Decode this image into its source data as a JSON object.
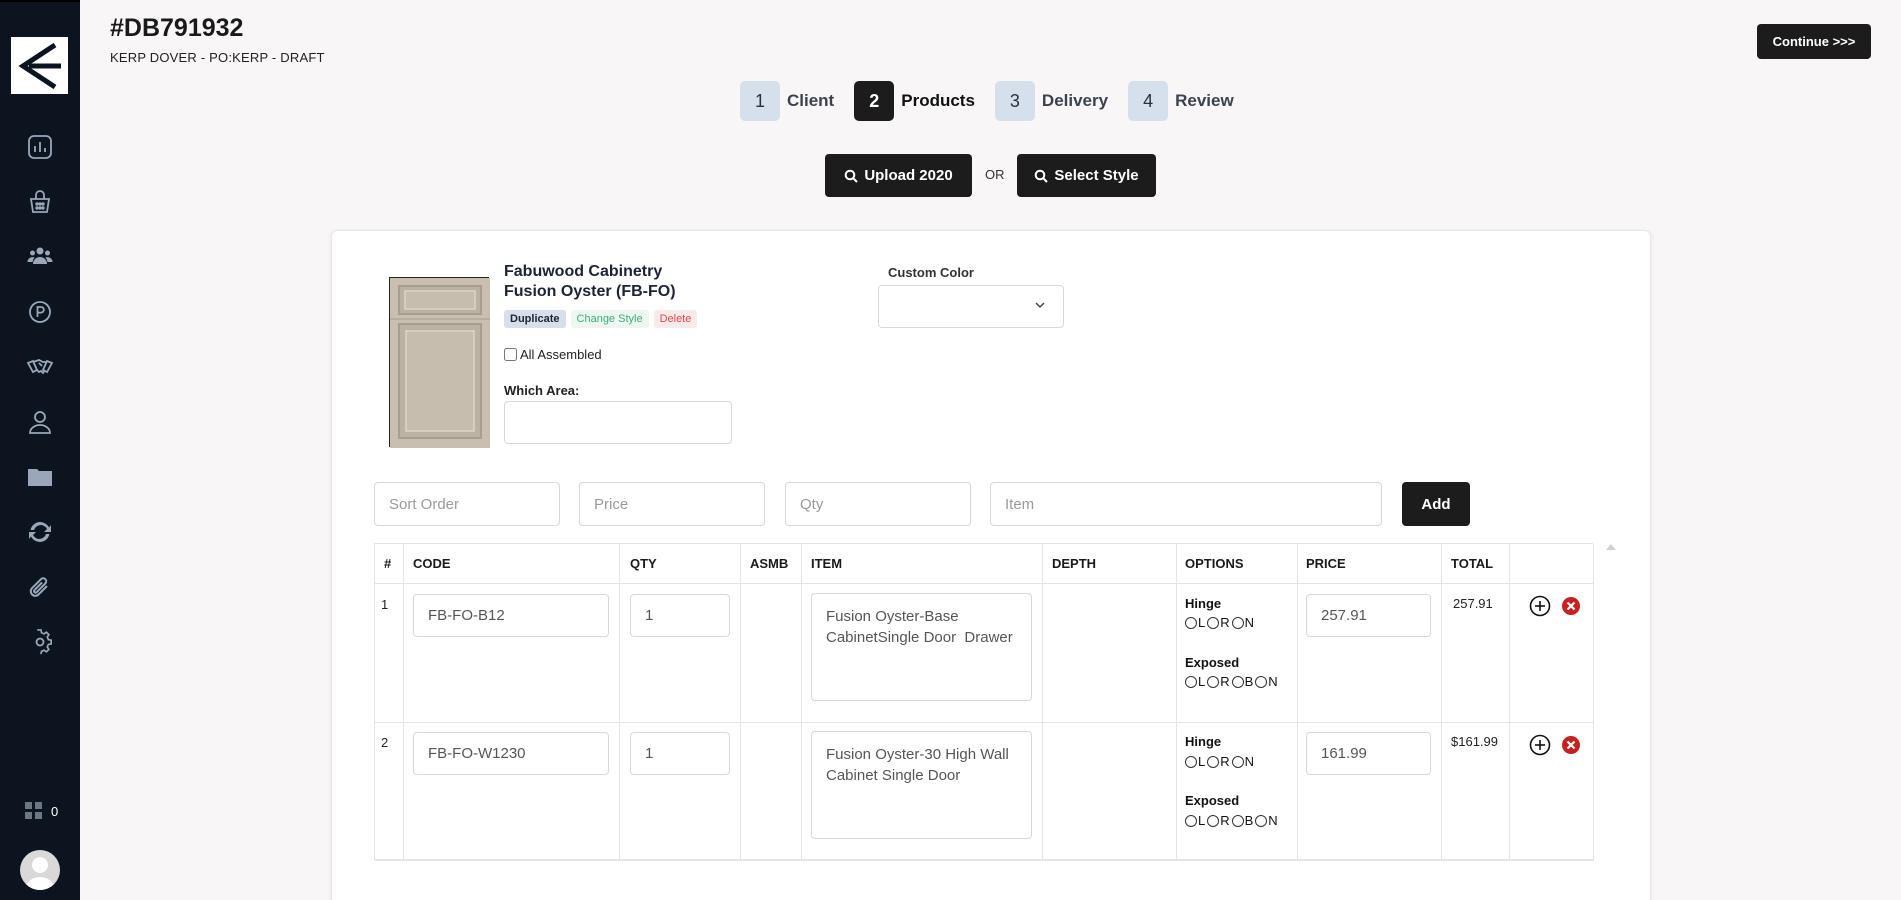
{
  "order": {
    "id": "#DB791932",
    "subtitle": "KERP DOVER - PO:KERP - DRAFT",
    "continue_label": "Continue >>>"
  },
  "sidebar": {
    "cart_count": "0"
  },
  "steps": [
    {
      "num": "1",
      "label": "Client"
    },
    {
      "num": "2",
      "label": "Products"
    },
    {
      "num": "3",
      "label": "Delivery"
    },
    {
      "num": "4",
      "label": "Review"
    }
  ],
  "actions": {
    "upload_label": "Upload 2020",
    "or_label": "OR",
    "select_label": "Select Style"
  },
  "product": {
    "brand": "Fabuwood Cabinetry",
    "style": "Fusion Oyster (FB-FO)",
    "duplicate_label": "Duplicate",
    "change_label": "Change Style",
    "delete_label": "Delete",
    "all_assembled_label": "All Assembled",
    "which_area_label": "Which Area:",
    "custom_color_label": "Custom Color"
  },
  "add_row": {
    "sort_placeholder": "Sort Order",
    "price_placeholder": "Price",
    "qty_placeholder": "Qty",
    "item_placeholder": "Item",
    "add_label": "Add"
  },
  "table": {
    "headers": {
      "num": "#",
      "code": "CODE",
      "qty": "QTY",
      "asmb": "ASMB",
      "item": "ITEM",
      "depth": "DEPTH",
      "options": "OPTIONS",
      "price": "PRICE",
      "total": "TOTAL"
    },
    "hinge_label": "Hinge",
    "exposed_label": "Exposed",
    "opt_L": "L",
    "opt_R": "R",
    "opt_B": "B",
    "opt_N": "N",
    "rows": [
      {
        "num": "1",
        "code": "FB-FO-B12",
        "qty": "1",
        "item": "Fusion Oyster-Base CabinetSingle Door  Drawer",
        "price": "257.91",
        "total": "257.91"
      },
      {
        "num": "2",
        "code": "FB-FO-W1230",
        "qty": "1",
        "item": "Fusion Oyster-30 High Wall Cabinet Single Door",
        "price": "161.99",
        "total": "$161.99"
      }
    ]
  },
  "colors": {
    "sidebar_bg": "#0c1420",
    "dark_button": "#1c1c1c",
    "step_inactive": "#d6e0ec",
    "delete_red": "#c8201e",
    "change_green": "#3cae76"
  }
}
